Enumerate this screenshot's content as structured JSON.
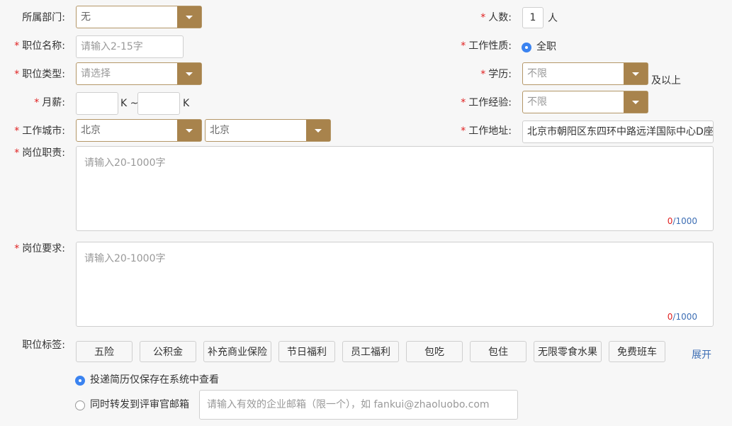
{
  "colors": {
    "accent": "#a8834c",
    "required": "#e02020",
    "radio": "#3b83f0",
    "link": "#3d6eb4"
  },
  "form": {
    "department": {
      "label": "所属部门:",
      "value": "无"
    },
    "headcount": {
      "label": "人数:",
      "value": "1",
      "unit": "人"
    },
    "position_name": {
      "label": "职位名称:",
      "placeholder": "请输入2-15字"
    },
    "job_nature": {
      "label": "工作性质:",
      "option": "全职"
    },
    "position_type": {
      "label": "职位类型:",
      "placeholder": "请选择"
    },
    "education": {
      "label": "学历:",
      "value": "不限",
      "suffix": "及以上"
    },
    "salary": {
      "label": "月薪:",
      "unit_min": "K ~",
      "unit_max": "K"
    },
    "experience": {
      "label": "工作经验:",
      "value": "不限"
    },
    "city": {
      "label": "工作城市:",
      "province": "北京",
      "city": "北京"
    },
    "address": {
      "label": "工作地址:",
      "value": "北京市朝阳区东四环中路远洋国际中心D座"
    },
    "duties": {
      "label": "岗位职责:",
      "placeholder": "请输入20-1000字",
      "count": "0",
      "max": "/1000"
    },
    "requirements": {
      "label": "岗位要求:",
      "placeholder": "请输入20-1000字",
      "count": "0",
      "max": "/1000"
    },
    "tags": {
      "label": "职位标签:",
      "items": [
        "五险",
        "公积金",
        "补充商业保险",
        "节日福利",
        "员工福利",
        "包吃",
        "包住",
        "无限零食水果",
        "免费班车"
      ],
      "expand": "展开"
    },
    "delivery": {
      "option_system": "投递简历仅保存在系统中查看",
      "option_email": "同时转发到评审官邮箱",
      "email_placeholder": "请输入有效的企业邮箱（限一个），如 fankui@zhaoluobo.com"
    }
  }
}
